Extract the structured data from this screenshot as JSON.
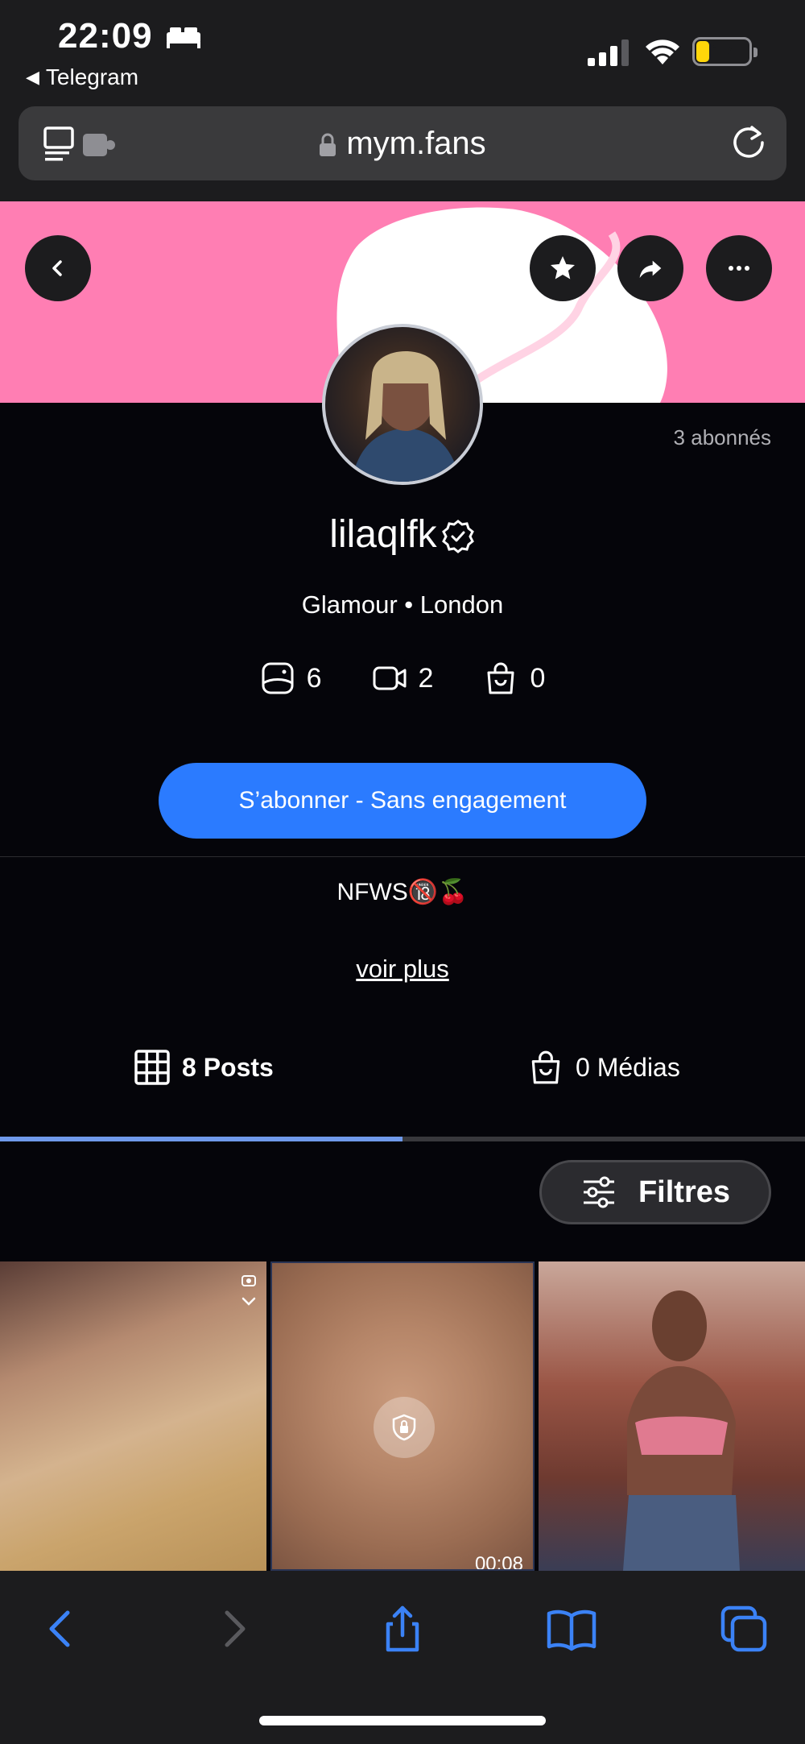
{
  "status_bar": {
    "time": "22:09",
    "back_app": "Telegram",
    "battery_level": "17",
    "colors": {
      "battery_fill": "#ffd60a"
    }
  },
  "browser": {
    "url": "mym.fans",
    "icons": [
      "reader-icon",
      "extension-icon",
      "lock-icon",
      "reload-icon"
    ]
  },
  "profile": {
    "subscribers": "3 abonnés",
    "username": "lilaqlfk",
    "tagline": "Glamour • London",
    "stats": {
      "photos": "6",
      "videos": "2",
      "products": "0"
    },
    "subscribe_label": "S’abonner - Sans engagement",
    "bio": "NFWS🔞🍒",
    "see_more": "voir plus"
  },
  "tabs": [
    {
      "label": "8 Posts",
      "active": true
    },
    {
      "label": "0 Médias",
      "active": false
    }
  ],
  "filters_label": "Filtres",
  "grid": {
    "video_duration": "00:08"
  },
  "colors": {
    "accent": "#2b7bff",
    "banner": "#ff7eb3",
    "tab_indicator": "#6f99ea"
  }
}
